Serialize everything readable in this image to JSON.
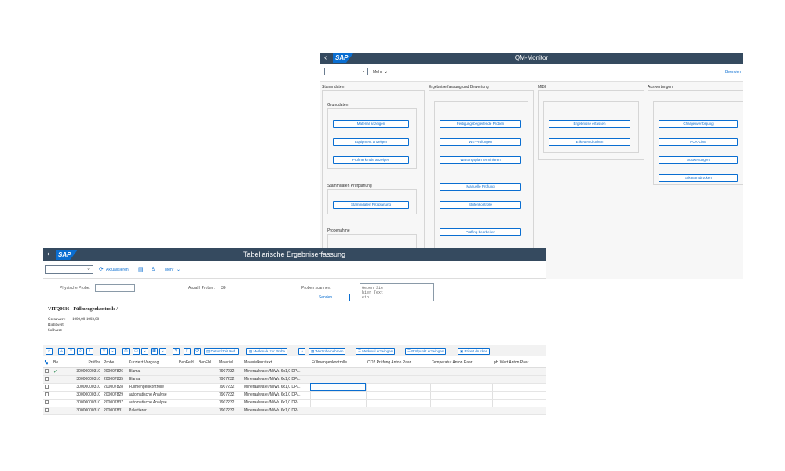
{
  "qm_monitor": {
    "sap_logo": "SAP",
    "title": "QM-Monitor",
    "toolbar": {
      "more": "Mehr",
      "exit": "Beenden"
    },
    "sections": [
      {
        "title": "Stammdaten",
        "groups": [
          {
            "title": "Grunddaten",
            "buttons": [
              "Material anzeigen",
              "Equipment anzeigen",
              "Prüfmerkmale anzeigen"
            ]
          },
          {
            "title": "Stammdaten Prüfplanung",
            "buttons": [
              "Stammdaten Prüfplanung"
            ]
          },
          {
            "title": "Probenahme",
            "buttons": []
          }
        ]
      },
      {
        "title": "Ergebniserfassung und Bewertung",
        "buttons": [
          "Fertigungsbegleitende Proben",
          "WE-Prüfungen",
          "Wartungsplan terminieren",
          "Manuelle Prüfung",
          "Stufenkontrolle",
          "Prüfling bearbeiten"
        ]
      },
      {
        "title": "MIBI",
        "buttons": [
          "Ergebnisse erfassen",
          "Etiketten drucken"
        ]
      },
      {
        "title": "Auswertungen",
        "buttons": [
          "Chargenverfolgung",
          "NOK-Liste",
          "Auswertungen",
          "Etiketten drucken"
        ]
      }
    ]
  },
  "tab_entry": {
    "sap_logo": "SAP",
    "title": "Tabellarische Ergebniserfassung",
    "toolbar": {
      "refresh": "Aktualisieren",
      "more": "Mehr"
    },
    "form": {
      "physical_sample_label": "Physische Probe:",
      "sample_count_label": "Anzahl Proben:",
      "sample_count_value": "30",
      "scan_label": "Proben scannen:",
      "send": "Senden",
      "textarea_placeholder": "Geben Sie\nhier Text\nein..."
    },
    "object_title": "VITQ0036 - Füllmengenkontrolle / -",
    "meta": {
      "limit_label": "Grenzwert:",
      "limit_value": "1000,00-1003,00",
      "guide_label": "Richtwert:",
      "target_label": "Sollwert:"
    },
    "grid_buttons": [
      "Datum/Zeit änd.",
      "Merkmale zur Probe",
      "Wert übernehmen",
      "Merkmal erzwingen",
      "Prüfpunkt erzwingen",
      "Etikett drucken"
    ],
    "columns": [
      "Be..",
      "Prüflos",
      "Probe",
      "Kurztext Vorgang",
      "BenFeld",
      "BenFld",
      "Material",
      "Materialkurztext",
      "Füllmengenkontrolle",
      "CO2 Prüfung Anton Paar",
      "Temperatur Anton Paar",
      "pH Wert Anton Paar"
    ],
    "rows": [
      {
        "status": "✓",
        "lot": "30000000310",
        "sample": "200007826",
        "op": "Blama",
        "material": "7907232",
        "mat_text": "Mineraalwater/MiWa 6x1,0  DP/..."
      },
      {
        "status": "",
        "lot": "30000000310",
        "sample": "200007835",
        "op": "Blama",
        "material": "7907232",
        "mat_text": "Mineraalwater/MiWa 6x1,0  DP/..."
      },
      {
        "status": "",
        "lot": "30000000310",
        "sample": "200007828",
        "op": "Füllmengenkontrolle",
        "material": "7907232",
        "mat_text": "Mineraalwater/MiWa 6x1,0  DP/..."
      },
      {
        "status": "",
        "lot": "30000000310",
        "sample": "200007829",
        "op": "automatische Analyse",
        "material": "7907232",
        "mat_text": "Mineraalwater/MiWa 6x1,0  DP/..."
      },
      {
        "status": "",
        "lot": "30000000310",
        "sample": "200007837",
        "op": "automatische Analyse",
        "material": "7907232",
        "mat_text": "Mineraalwater/MiWa 6x1,0  DP/..."
      },
      {
        "status": "",
        "lot": "30000000310",
        "sample": "200007831",
        "op": "Palettierer",
        "material": "7907232",
        "mat_text": "Mineraalwater/MiWa 6x1,0  DP/..."
      }
    ]
  }
}
